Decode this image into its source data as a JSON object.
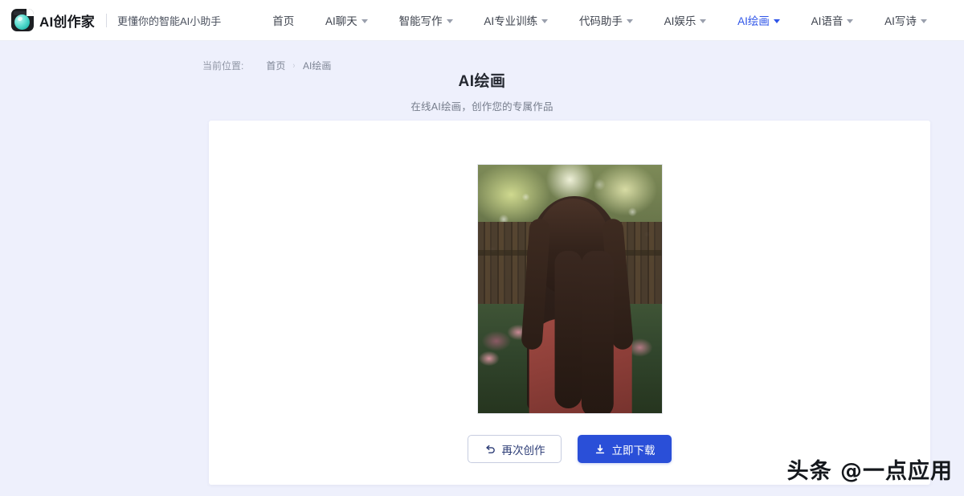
{
  "navbar": {
    "logo_icon": "camera-logo-icon",
    "brand_name": "AI创作家",
    "tagline": "更懂你的智能AI小助手",
    "accent_color": "#2f55e8",
    "menu": [
      {
        "label": "首页",
        "has_caret": false,
        "active": false
      },
      {
        "label": "AI聊天",
        "has_caret": true,
        "active": false
      },
      {
        "label": "智能写作",
        "has_caret": true,
        "active": false
      },
      {
        "label": "AI专业训练",
        "has_caret": true,
        "active": false
      },
      {
        "label": "代码助手",
        "has_caret": true,
        "active": false
      },
      {
        "label": "AI娱乐",
        "has_caret": true,
        "active": false
      },
      {
        "label": "AI绘画",
        "has_caret": true,
        "active": true
      },
      {
        "label": "AI语音",
        "has_caret": true,
        "active": false
      },
      {
        "label": "AI写诗",
        "has_caret": true,
        "active": false
      }
    ]
  },
  "breadcrumb": {
    "label": "当前位置:",
    "home": "首页",
    "separator": "›",
    "current": "AI绘画"
  },
  "page": {
    "title": "AI绘画",
    "subtitle": "在线AI绘画，创作您的专属作品"
  },
  "result": {
    "image_alt": "AI生成的人像作品：花园中长发女子，红色碎花上衣",
    "buttons": {
      "regenerate": {
        "label": "再次创作",
        "icon": "undo-arrow-icon"
      },
      "download": {
        "label": "立即下载",
        "icon": "download-icon",
        "color": "#2a4fd8"
      }
    }
  },
  "watermark": {
    "text": "头条 @一点应用"
  }
}
